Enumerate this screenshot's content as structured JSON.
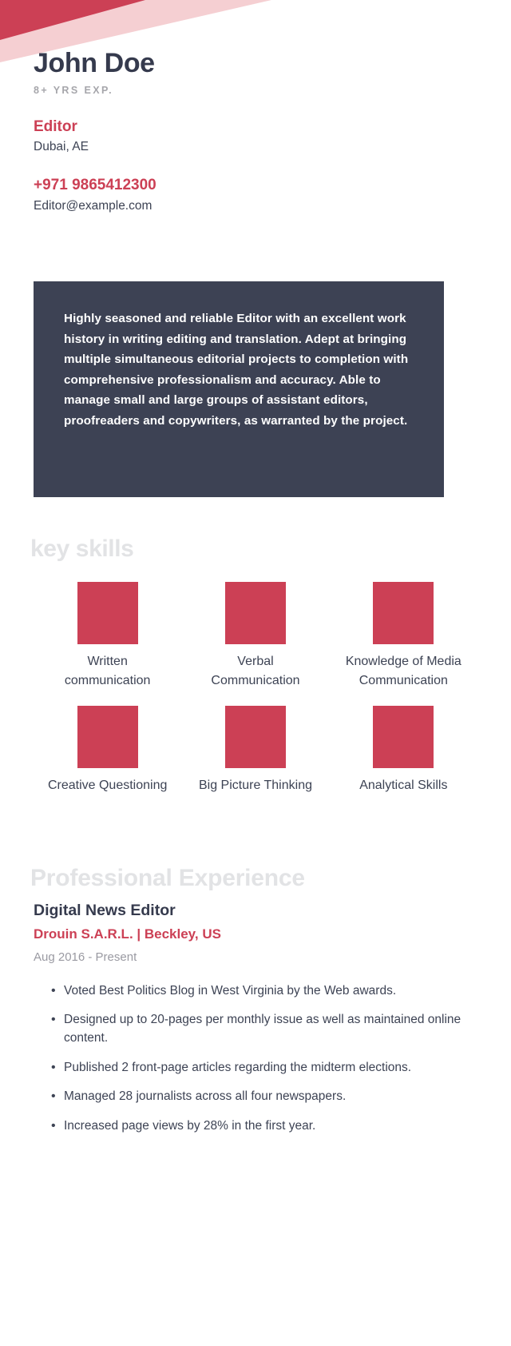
{
  "theme": {
    "accent_red": "#cc4055",
    "accent_pink": "#f5cfd2",
    "dark_panel": "#3d4254",
    "heading_gray": "#e2e3e5",
    "body_text": "#3d4354",
    "muted_text": "#9a9aa2"
  },
  "header": {
    "name": "John Doe",
    "years_experience": "8+ YRS EXP.",
    "job_title": "Editor",
    "location": "Dubai, AE",
    "phone": "+971 9865412300",
    "email": "Editor@example.com"
  },
  "summary": {
    "text": "Highly seasoned and reliable Editor with an excellent work history in writing editing and translation. Adept at bringing multiple simultaneous editorial projects to completion with comprehensive professionalism and accuracy. Able to manage small and large groups of assistant editors, proofreaders and copywriters, as warranted by the project."
  },
  "key_skills": {
    "heading": "key skills",
    "items": [
      {
        "label": "Written communication"
      },
      {
        "label": "Verbal Communication"
      },
      {
        "label": "Knowledge of Media Communication"
      },
      {
        "label": "Creative Questioning"
      },
      {
        "label": "Big Picture Thinking"
      },
      {
        "label": "Analytical Skills"
      }
    ]
  },
  "experience": {
    "heading": "Professional Experience",
    "jobs": [
      {
        "role": "Digital News Editor",
        "company": "Drouin S.A.R.L. | Beckley, US",
        "dates": "Aug 2016 - Present",
        "bullets": [
          "Voted Best Politics Blog in West Virginia by the Web awards.",
          "Designed up to 20-pages per monthly issue as well as maintained online content.",
          "Published 2 front-page articles regarding the midterm elections.",
          "Managed 28 journalists across all four newspapers.",
          "Increased page views by 28% in the first year."
        ]
      }
    ]
  }
}
